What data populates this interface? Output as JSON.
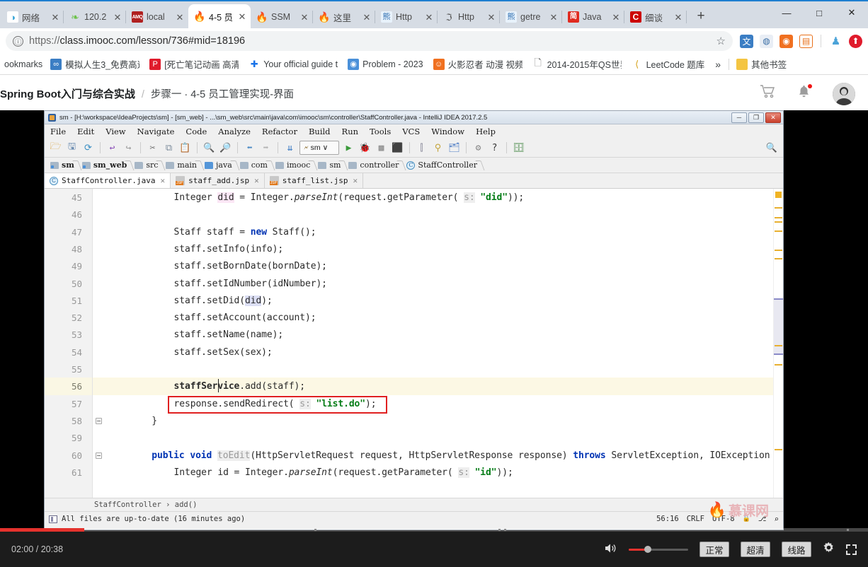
{
  "browser": {
    "tabs": [
      {
        "title": "网络",
        "icon": "sogou-icon",
        "favclass": "fav-sogou",
        "glyph": "◑",
        "active": false
      },
      {
        "title": "120.2",
        "icon": "spring-leaf-icon",
        "favclass": "fav-leaf",
        "glyph": "❧",
        "active": false
      },
      {
        "title": "local",
        "icon": "activemq-icon",
        "favclass": "fav-amq",
        "glyph": "AMQ",
        "active": false
      },
      {
        "title": "4-5 员",
        "icon": "imooc-flame-icon",
        "favclass": "fav-flame",
        "glyph": "🔥",
        "active": true
      },
      {
        "title": "SSM",
        "icon": "imooc-flame-icon",
        "favclass": "fav-flame",
        "glyph": "🔥",
        "active": false
      },
      {
        "title": "这里",
        "icon": "imooc-flame-icon",
        "favclass": "fav-flame",
        "glyph": "🔥",
        "active": false
      },
      {
        "title": "Http",
        "icon": "baidu-icon",
        "favclass": "fav-baidu",
        "glyph": "熊",
        "active": false
      },
      {
        "title": "Http",
        "icon": "script-icon",
        "favclass": "fav-doc",
        "glyph": "ℑ",
        "active": false
      },
      {
        "title": "getre",
        "icon": "baidu-icon",
        "favclass": "fav-baidu",
        "glyph": "熊",
        "active": false
      },
      {
        "title": "Java",
        "icon": "jianshu-icon",
        "favclass": "fav-jian",
        "glyph": "简",
        "active": false
      },
      {
        "title": "细谈",
        "icon": "csdn-icon",
        "favclass": "fav-c",
        "glyph": "C",
        "active": false
      }
    ],
    "new_tab_label": "+",
    "close_label": "✕",
    "window_buttons": {
      "minimize": "—",
      "maximize": "□",
      "close": "✕"
    },
    "address": {
      "info_icon": "ⓘ",
      "url_scheme": "https://",
      "url_main": "class.imooc.com/lesson/736#mid=18196",
      "url_full": "https://class.imooc.com/lesson/736#mid=18196",
      "star_icon": "☆"
    },
    "extensions": [
      {
        "name": "translate-extension",
        "color": "#3b7ec4",
        "glyph": "文"
      },
      {
        "name": "opera-extension",
        "color": "#3a6ea5",
        "glyph": "◍"
      },
      {
        "name": "orange-extension",
        "color": "#f07020",
        "glyph": "◉"
      },
      {
        "name": "list-extension",
        "color": "#e8701a",
        "glyph": "▤"
      },
      {
        "name": "pen-extension",
        "color": "#4ba3d8",
        "glyph": "✎"
      },
      {
        "name": "upload-extension",
        "color": "#e01b2c",
        "glyph": "⬆"
      }
    ],
    "bookmarks": {
      "leading_label": "ookmarks",
      "items": [
        {
          "label": "模拟人生3_免费高速",
          "icon": "bm-generic-icon",
          "color": "#3b7ec4",
          "glyph": "∞"
        },
        {
          "label": "[死亡笔记动画 高清",
          "icon": "pptv-icon",
          "color": "#e01b2c",
          "glyph": "P"
        },
        {
          "label": "Your official guide t",
          "icon": "plus-icon",
          "color": "#1a73e8",
          "glyph": "✚"
        },
        {
          "label": "Problem - 2023",
          "icon": "globe-icon",
          "color": "#4a90d9",
          "glyph": "◉"
        },
        {
          "label": "火影忍者 动漫 视频_",
          "icon": "face-icon",
          "color": "#f07020",
          "glyph": "☺"
        },
        {
          "label": "2014-2015年QS世界",
          "icon": "page-icon",
          "color": "#6a6a6a",
          "glyph": "🗋"
        },
        {
          "label": "LeetCode 题库",
          "icon": "leetcode-icon",
          "color": "#d4a017",
          "glyph": "⟨"
        }
      ],
      "overflow_label": "»",
      "other_label": "其他书签",
      "other_icon_glyph": "▭"
    }
  },
  "page": {
    "breadcrumb": {
      "course": "Spring Boot入门与综合实战",
      "separator": "/",
      "step": "步骤一 · 4-5 员工管理实现-界面"
    },
    "actions": {
      "cart_icon": "🛒",
      "bell_icon": "🔔",
      "avatar_label": "user-avatar"
    }
  },
  "ide": {
    "title": "sm - [H:\\workspace\\IdeaProjects\\sm] - [sm_web] - ...\\sm_web\\src\\main\\java\\com\\imooc\\sm\\controller\\StaffController.java - IntelliJ IDEA 2017.2.5",
    "window_buttons": {
      "minimize": "─",
      "maximize": "❐",
      "close": "✕"
    },
    "menu": [
      "File",
      "Edit",
      "View",
      "Navigate",
      "Code",
      "Analyze",
      "Refactor",
      "Build",
      "Run",
      "Tools",
      "VCS",
      "Window",
      "Help"
    ],
    "toolbar": {
      "icons": [
        {
          "name": "open-folder-icon",
          "glyph": "📂",
          "color": "#d9a441"
        },
        {
          "name": "save-all-icon",
          "glyph": "💾",
          "color": "#5a7fa8"
        },
        {
          "name": "sync-icon",
          "glyph": "⟳",
          "color": "#3a8fc4"
        },
        {
          "name": "undo-icon",
          "glyph": "↩",
          "color": "#8a4fb8"
        },
        {
          "name": "redo-icon",
          "glyph": "↪",
          "color": "#9a9a9a"
        },
        {
          "name": "cut-icon",
          "glyph": "✂",
          "color": "#6a6a6a"
        },
        {
          "name": "copy-icon",
          "glyph": "🗐",
          "color": "#7a8a9a"
        },
        {
          "name": "paste-icon",
          "glyph": "📋",
          "color": "#c88a3a"
        },
        {
          "name": "find-icon",
          "glyph": "🔍",
          "color": "#4a6a8a"
        },
        {
          "name": "replace-icon",
          "glyph": "🔎",
          "color": "#4a6a8a"
        },
        {
          "name": "back-icon",
          "glyph": "⬅",
          "color": "#4a8ac4"
        },
        {
          "name": "forward-icon",
          "glyph": "➡",
          "color": "#b4b4b4"
        },
        {
          "name": "update-project-icon",
          "glyph": "⇊",
          "color": "#3a7ac4"
        }
      ],
      "run_config_label": "sm",
      "run_config_caret": "∨",
      "run_icons": [
        {
          "name": "run-icon",
          "glyph": "▶",
          "color": "#3a9a3a"
        },
        {
          "name": "debug-icon",
          "glyph": "🐞",
          "color": "#3a8a3a"
        },
        {
          "name": "coverage-icon",
          "glyph": "▦",
          "color": "#8a8a8a"
        },
        {
          "name": "stop-icon",
          "glyph": "⬛",
          "color": "#9a9a9a"
        },
        {
          "name": "profile-icon",
          "glyph": "⫿",
          "color": "#8a8a9a"
        },
        {
          "name": "update-app-icon",
          "glyph": "⚲",
          "color": "#c4a43a"
        },
        {
          "name": "structure-icon",
          "glyph": "🗂",
          "color": "#4a7ac4"
        },
        {
          "name": "hierarchy-icon",
          "glyph": "⚙",
          "color": "#8a8a8a"
        },
        {
          "name": "help-icon",
          "glyph": "?",
          "color": "#4a4a4a"
        },
        {
          "name": "database-icon",
          "glyph": "🗄",
          "color": "#4a8a4a"
        }
      ],
      "search_icon": "🔍"
    },
    "breadcrumbs": [
      {
        "label": "sm",
        "type": "module",
        "bold": true
      },
      {
        "label": "sm_web",
        "type": "module",
        "bold": true
      },
      {
        "label": "src",
        "type": "folder",
        "bold": false
      },
      {
        "label": "main",
        "type": "folder",
        "bold": false
      },
      {
        "label": "java",
        "type": "source-folder",
        "bold": false
      },
      {
        "label": "com",
        "type": "package",
        "bold": false
      },
      {
        "label": "imooc",
        "type": "package",
        "bold": false
      },
      {
        "label": "sm",
        "type": "package",
        "bold": false
      },
      {
        "label": "controller",
        "type": "package",
        "bold": false
      },
      {
        "label": "StaffController",
        "type": "class",
        "bold": false
      }
    ],
    "editor_tabs": [
      {
        "label": "StaffController.java",
        "type": "java",
        "active": true,
        "close": "✕"
      },
      {
        "label": "staff_add.jsp",
        "type": "jsp",
        "active": false,
        "close": "✕"
      },
      {
        "label": "staff_list.jsp",
        "type": "jsp",
        "active": false,
        "close": "✕"
      }
    ],
    "code": {
      "first_line_number": 45,
      "current_line": 56,
      "lines": [
        {
          "n": 45,
          "indent": 8,
          "tokens": [
            {
              "t": "Integer ",
              "c": ""
            },
            {
              "t": "did",
              "c": "var-pink"
            },
            {
              "t": " = Integer.",
              "c": ""
            },
            {
              "t": "parseInt",
              "c": "it"
            },
            {
              "t": "(request.getParameter( ",
              "c": ""
            },
            {
              "t": "s:",
              "c": "hint"
            },
            {
              "t": " ",
              "c": ""
            },
            {
              "t": "\"did\"",
              "c": "str"
            },
            {
              "t": "));",
              "c": ""
            }
          ]
        },
        {
          "n": 46,
          "indent": 0,
          "tokens": []
        },
        {
          "n": 47,
          "indent": 8,
          "tokens": [
            {
              "t": "Staff staff = ",
              "c": ""
            },
            {
              "t": "new",
              "c": "kw"
            },
            {
              "t": " Staff();",
              "c": ""
            }
          ]
        },
        {
          "n": 48,
          "indent": 8,
          "tokens": [
            {
              "t": "staff.setInfo(info);",
              "c": ""
            }
          ]
        },
        {
          "n": 49,
          "indent": 8,
          "tokens": [
            {
              "t": "staff.setBornDate(bornDate);",
              "c": ""
            }
          ]
        },
        {
          "n": 50,
          "indent": 8,
          "tokens": [
            {
              "t": "staff.setIdNumber(idNumber);",
              "c": ""
            }
          ]
        },
        {
          "n": 51,
          "indent": 8,
          "tokens": [
            {
              "t": "staff.setDid(",
              "c": ""
            },
            {
              "t": "did",
              "c": "var-blue"
            },
            {
              "t": ");",
              "c": ""
            }
          ]
        },
        {
          "n": 52,
          "indent": 8,
          "tokens": [
            {
              "t": "staff.setAccount(account);",
              "c": ""
            }
          ]
        },
        {
          "n": 53,
          "indent": 8,
          "tokens": [
            {
              "t": "staff.setName(name);",
              "c": ""
            }
          ]
        },
        {
          "n": 54,
          "indent": 8,
          "tokens": [
            {
              "t": "staff.setSex(sex);",
              "c": ""
            }
          ]
        },
        {
          "n": 55,
          "indent": 0,
          "tokens": []
        },
        {
          "n": 56,
          "indent": 8,
          "tokens": [
            {
              "t": "staffService",
              "c": "bold"
            },
            {
              "t": ".add(staff);",
              "c": ""
            }
          ]
        },
        {
          "n": 57,
          "indent": 8,
          "tokens": [
            {
              "t": "response.sendRedirect( ",
              "c": ""
            },
            {
              "t": "s:",
              "c": "hint"
            },
            {
              "t": " ",
              "c": ""
            },
            {
              "t": "\"list.do\"",
              "c": "str"
            },
            {
              "t": ");",
              "c": ""
            }
          ]
        },
        {
          "n": 58,
          "indent": 4,
          "tokens": [
            {
              "t": "}",
              "c": ""
            }
          ]
        },
        {
          "n": 59,
          "indent": 0,
          "tokens": []
        },
        {
          "n": 60,
          "indent": 4,
          "tokens": [
            {
              "t": "public void",
              "c": "kw"
            },
            {
              "t": " ",
              "c": ""
            },
            {
              "t": "toEdit",
              "c": "hint"
            },
            {
              "t": "(HttpServletRequest request, HttpServletResponse response) ",
              "c": ""
            },
            {
              "t": "throws",
              "c": "kw"
            },
            {
              "t": " ServletException, IOException",
              "c": ""
            }
          ]
        },
        {
          "n": 61,
          "indent": 8,
          "tokens": [
            {
              "t": "Integer id = Integer.",
              "c": ""
            },
            {
              "t": "parseInt",
              "c": "it"
            },
            {
              "t": "(request.getParameter( ",
              "c": ""
            },
            {
              "t": "s:",
              "c": "hint"
            },
            {
              "t": " ",
              "c": ""
            },
            {
              "t": "\"id\"",
              "c": "str"
            },
            {
              "t": "));",
              "c": ""
            }
          ]
        }
      ],
      "highlight_box_line": 57
    },
    "bottom_breadcrumb": "StaffController  ›  add()",
    "status": {
      "message": "All files are up-to-date (16 minutes ago)",
      "caret_position": "56:16",
      "line_separator": "CRLF",
      "encoding": "UTF-8",
      "lock_icon": "🔒",
      "branch_icon": "⎇",
      "inspect_icon": "⌕"
    },
    "watermark": {
      "flame": "🔥",
      "text": "慕课网"
    }
  },
  "player": {
    "current_time": "02:00",
    "time_separator": "/",
    "duration": "20:38",
    "progress_percent": 9.7,
    "volume_icon": "🔊",
    "volume_percent": 31,
    "speed_label": "正常",
    "quality_label": "超清",
    "line_label": "线路",
    "settings_icon": "⚙",
    "fullscreen_icon": "fullscreen-icon",
    "colors": {
      "accent": "#e5322d",
      "bar_bg": "#1c1c1c"
    }
  }
}
